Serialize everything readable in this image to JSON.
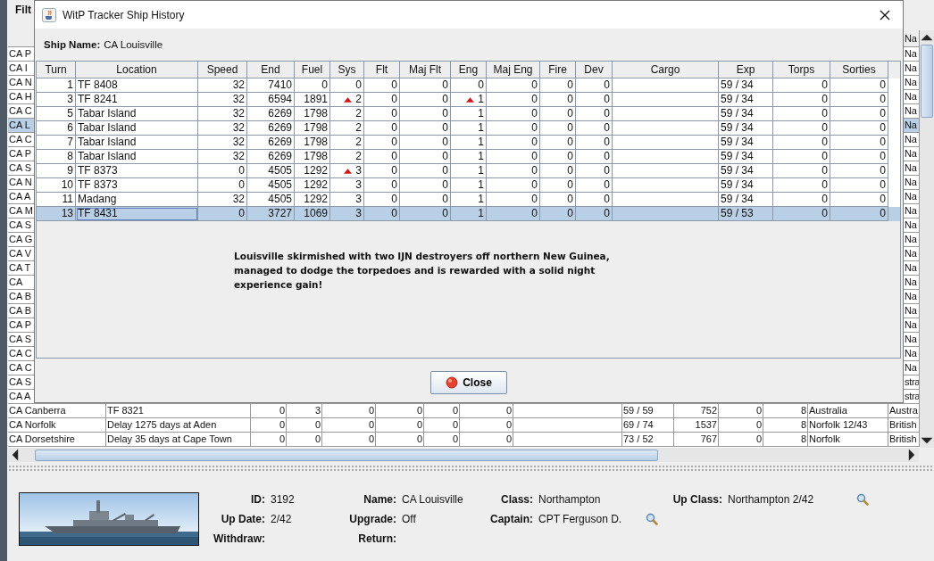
{
  "app": {
    "filter_label": "Filt"
  },
  "background_table": {
    "visible_header": "Na",
    "rows": [
      {
        "kind": "partial",
        "name": "CA P",
        "last": "Na",
        "selected": false
      },
      {
        "kind": "partial",
        "name": "CA I",
        "last": "Na",
        "selected": false
      },
      {
        "kind": "partial",
        "name": "CA N",
        "last": "Na",
        "selected": false
      },
      {
        "kind": "partial",
        "name": "CA H",
        "last": "Na",
        "selected": false
      },
      {
        "kind": "partial",
        "name": "CA C",
        "last": "Na",
        "selected": false
      },
      {
        "kind": "partial",
        "name": "CA L",
        "last": "Na",
        "selected": true
      },
      {
        "kind": "partial",
        "name": "CA C",
        "last": "Na",
        "selected": false
      },
      {
        "kind": "partial",
        "name": "CA P",
        "last": "Na",
        "selected": false
      },
      {
        "kind": "partial",
        "name": "CA S",
        "last": "Na",
        "selected": false
      },
      {
        "kind": "partial",
        "name": "CA N",
        "last": "Na",
        "selected": false
      },
      {
        "kind": "partial",
        "name": "CA A",
        "last": "Na",
        "selected": false
      },
      {
        "kind": "partial",
        "name": "CA M",
        "last": "Na",
        "selected": false
      },
      {
        "kind": "partial",
        "name": "CA S",
        "last": "Na",
        "selected": false
      },
      {
        "kind": "partial",
        "name": "CA G",
        "last": "Na",
        "selected": false
      },
      {
        "kind": "partial",
        "name": "CA V",
        "last": "Na",
        "selected": false
      },
      {
        "kind": "partial",
        "name": "CA T",
        "last": "Na",
        "selected": false
      },
      {
        "kind": "partial",
        "name": "CA",
        "last": "Na",
        "selected": false
      },
      {
        "kind": "partial",
        "name": "CA B",
        "last": "Na",
        "selected": false
      },
      {
        "kind": "partial",
        "name": "CA B",
        "last": "Na",
        "selected": false
      },
      {
        "kind": "partial",
        "name": "CA P",
        "last": "Na",
        "selected": false
      },
      {
        "kind": "partial",
        "name": "CA S",
        "last": "Na",
        "selected": false
      },
      {
        "kind": "partial",
        "name": "CA C",
        "last": "Na",
        "selected": false
      },
      {
        "kind": "partial",
        "name": "CA C",
        "last": "Na",
        "selected": false
      },
      {
        "kind": "partial",
        "name": "CA S",
        "last": "stra",
        "selected": false
      },
      {
        "kind": "partial",
        "name": "CA A",
        "last": "stra",
        "selected": false
      },
      {
        "kind": "full",
        "cells": [
          "CA Canberra",
          "TF 8321",
          "0",
          "3",
          "0",
          "0",
          "0",
          "0",
          "59 / 59",
          "752",
          "0",
          "8",
          "Australia",
          "Austra"
        ],
        "selected": false
      },
      {
        "kind": "full",
        "cells": [
          "CA Norfolk",
          "Delay 1275 days at Aden",
          "0",
          "0",
          "0",
          "0",
          "0",
          "0",
          "69 / 74",
          "1537",
          "0",
          "8",
          "Norfolk 12/43",
          "British"
        ],
        "selected": false
      },
      {
        "kind": "full",
        "cells": [
          "CA Dorsetshire",
          "Delay 35 days at Cape Town",
          "0",
          "0",
          "0",
          "0",
          "0",
          "0",
          "73 / 52",
          "767",
          "0",
          "8",
          "Norfolk",
          "British"
        ],
        "selected": false
      }
    ]
  },
  "dialog": {
    "title": "WitP Tracker Ship History",
    "ship_name_label": "Ship Name:",
    "ship_name": "CA Louisville",
    "columns": [
      "Turn",
      "Location",
      "Speed",
      "End",
      "Fuel",
      "Sys",
      "Flt",
      "Maj Flt",
      "Eng",
      "Maj Eng",
      "Fire",
      "Dev",
      "Cargo",
      "Exp",
      "Torps",
      "Sorties"
    ],
    "rows": [
      {
        "turn": "1",
        "location": "TF 8408",
        "speed": "32",
        "end": "7410",
        "fuel": "0",
        "sys": "0",
        "sys_rising": false,
        "flt": "0",
        "maj_flt": "0",
        "eng": "0",
        "eng_rising": false,
        "maj_eng": "0",
        "fire": "0",
        "dev": "0",
        "exp": "59 / 34",
        "torps": "0",
        "sorties": "0",
        "selected": false
      },
      {
        "turn": "3",
        "location": "TF 8241",
        "speed": "32",
        "end": "6594",
        "fuel": "1891",
        "sys": "2",
        "sys_rising": true,
        "flt": "0",
        "maj_flt": "0",
        "eng": "1",
        "eng_rising": true,
        "maj_eng": "0",
        "fire": "0",
        "dev": "0",
        "exp": "59 / 34",
        "torps": "0",
        "sorties": "0",
        "selected": false
      },
      {
        "turn": "5",
        "location": "Tabar Island",
        "speed": "32",
        "end": "6269",
        "fuel": "1798",
        "sys": "2",
        "sys_rising": false,
        "flt": "0",
        "maj_flt": "0",
        "eng": "1",
        "eng_rising": false,
        "maj_eng": "0",
        "fire": "0",
        "dev": "0",
        "exp": "59 / 34",
        "torps": "0",
        "sorties": "0",
        "selected": false
      },
      {
        "turn": "6",
        "location": "Tabar Island",
        "speed": "32",
        "end": "6269",
        "fuel": "1798",
        "sys": "2",
        "sys_rising": false,
        "flt": "0",
        "maj_flt": "0",
        "eng": "1",
        "eng_rising": false,
        "maj_eng": "0",
        "fire": "0",
        "dev": "0",
        "exp": "59 / 34",
        "torps": "0",
        "sorties": "0",
        "selected": false
      },
      {
        "turn": "7",
        "location": "Tabar Island",
        "speed": "32",
        "end": "6269",
        "fuel": "1798",
        "sys": "2",
        "sys_rising": false,
        "flt": "0",
        "maj_flt": "0",
        "eng": "1",
        "eng_rising": false,
        "maj_eng": "0",
        "fire": "0",
        "dev": "0",
        "exp": "59 / 34",
        "torps": "0",
        "sorties": "0",
        "selected": false
      },
      {
        "turn": "8",
        "location": "Tabar Island",
        "speed": "32",
        "end": "6269",
        "fuel": "1798",
        "sys": "2",
        "sys_rising": false,
        "flt": "0",
        "maj_flt": "0",
        "eng": "1",
        "eng_rising": false,
        "maj_eng": "0",
        "fire": "0",
        "dev": "0",
        "exp": "59 / 34",
        "torps": "0",
        "sorties": "0",
        "selected": false
      },
      {
        "turn": "9",
        "location": "TF 8373",
        "speed": "0",
        "end": "4505",
        "fuel": "1292",
        "sys": "3",
        "sys_rising": true,
        "flt": "0",
        "maj_flt": "0",
        "eng": "1",
        "eng_rising": false,
        "maj_eng": "0",
        "fire": "0",
        "dev": "0",
        "exp": "59 / 34",
        "torps": "0",
        "sorties": "0",
        "selected": false
      },
      {
        "turn": "10",
        "location": "TF 8373",
        "speed": "0",
        "end": "4505",
        "fuel": "1292",
        "sys": "3",
        "sys_rising": false,
        "flt": "0",
        "maj_flt": "0",
        "eng": "1",
        "eng_rising": false,
        "maj_eng": "0",
        "fire": "0",
        "dev": "0",
        "exp": "59 / 34",
        "torps": "0",
        "sorties": "0",
        "selected": false
      },
      {
        "turn": "11",
        "location": "Madang",
        "speed": "32",
        "end": "4505",
        "fuel": "1292",
        "sys": "3",
        "sys_rising": false,
        "flt": "0",
        "maj_flt": "0",
        "eng": "1",
        "eng_rising": false,
        "maj_eng": "0",
        "fire": "0",
        "dev": "0",
        "exp": "59 / 34",
        "torps": "0",
        "sorties": "0",
        "selected": false
      },
      {
        "turn": "13",
        "location": "TF 8431",
        "speed": "0",
        "end": "3727",
        "fuel": "1069",
        "sys": "3",
        "sys_rising": false,
        "flt": "0",
        "maj_flt": "0",
        "eng": "1",
        "eng_rising": false,
        "maj_eng": "0",
        "fire": "0",
        "dev": "0",
        "exp": "59 / 53",
        "torps": "0",
        "sorties": "0",
        "selected": true
      }
    ],
    "message": "Louisville skirmished with two IJN destroyers off northern New Guinea, managed to dodge the torpedoes and is rewarded with a solid night experience gain!",
    "close_button": "Close"
  },
  "details": {
    "rows": [
      [
        {
          "label": "ID:",
          "value": "3192",
          "lookup": false
        },
        {
          "label": "Name:",
          "value": "CA Louisville",
          "lookup": false
        },
        {
          "label": "Class:",
          "value": "Northampton",
          "lookup": false
        },
        {
          "label": "Up Class:",
          "value": "Northampton 2/42",
          "lookup": true
        }
      ],
      [
        {
          "label": "Up Date:",
          "value": "2/42",
          "lookup": false
        },
        {
          "label": "Upgrade:",
          "value": "Off",
          "lookup": false
        },
        {
          "label": "Captain:",
          "value": "CPT Ferguson D.",
          "lookup": true
        }
      ],
      [
        {
          "label": "Withdraw:",
          "lookup": false
        },
        {
          "label": "Return:",
          "lookup": false
        }
      ]
    ]
  }
}
